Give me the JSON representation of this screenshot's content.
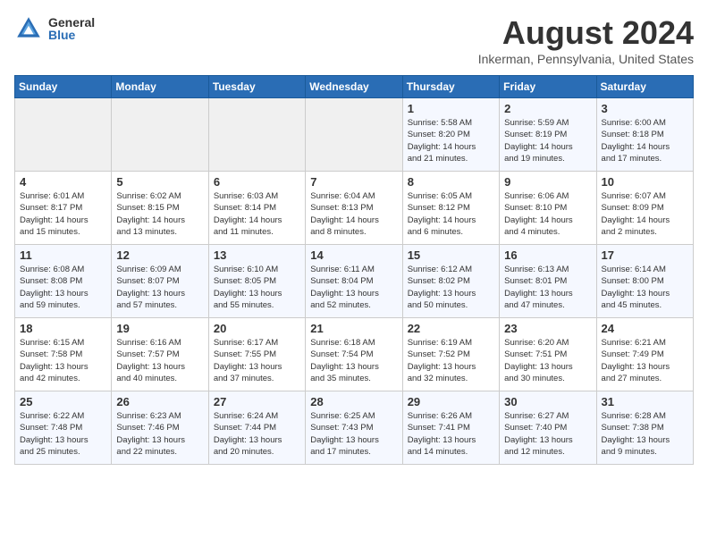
{
  "logo": {
    "general": "General",
    "blue": "Blue"
  },
  "title": {
    "month_year": "August 2024",
    "location": "Inkerman, Pennsylvania, United States"
  },
  "weekdays": [
    "Sunday",
    "Monday",
    "Tuesday",
    "Wednesday",
    "Thursday",
    "Friday",
    "Saturday"
  ],
  "weeks": [
    [
      {
        "day": "",
        "content": ""
      },
      {
        "day": "",
        "content": ""
      },
      {
        "day": "",
        "content": ""
      },
      {
        "day": "",
        "content": ""
      },
      {
        "day": "1",
        "content": "Sunrise: 5:58 AM\nSunset: 8:20 PM\nDaylight: 14 hours\nand 21 minutes."
      },
      {
        "day": "2",
        "content": "Sunrise: 5:59 AM\nSunset: 8:19 PM\nDaylight: 14 hours\nand 19 minutes."
      },
      {
        "day": "3",
        "content": "Sunrise: 6:00 AM\nSunset: 8:18 PM\nDaylight: 14 hours\nand 17 minutes."
      }
    ],
    [
      {
        "day": "4",
        "content": "Sunrise: 6:01 AM\nSunset: 8:17 PM\nDaylight: 14 hours\nand 15 minutes."
      },
      {
        "day": "5",
        "content": "Sunrise: 6:02 AM\nSunset: 8:15 PM\nDaylight: 14 hours\nand 13 minutes."
      },
      {
        "day": "6",
        "content": "Sunrise: 6:03 AM\nSunset: 8:14 PM\nDaylight: 14 hours\nand 11 minutes."
      },
      {
        "day": "7",
        "content": "Sunrise: 6:04 AM\nSunset: 8:13 PM\nDaylight: 14 hours\nand 8 minutes."
      },
      {
        "day": "8",
        "content": "Sunrise: 6:05 AM\nSunset: 8:12 PM\nDaylight: 14 hours\nand 6 minutes."
      },
      {
        "day": "9",
        "content": "Sunrise: 6:06 AM\nSunset: 8:10 PM\nDaylight: 14 hours\nand 4 minutes."
      },
      {
        "day": "10",
        "content": "Sunrise: 6:07 AM\nSunset: 8:09 PM\nDaylight: 14 hours\nand 2 minutes."
      }
    ],
    [
      {
        "day": "11",
        "content": "Sunrise: 6:08 AM\nSunset: 8:08 PM\nDaylight: 13 hours\nand 59 minutes."
      },
      {
        "day": "12",
        "content": "Sunrise: 6:09 AM\nSunset: 8:07 PM\nDaylight: 13 hours\nand 57 minutes."
      },
      {
        "day": "13",
        "content": "Sunrise: 6:10 AM\nSunset: 8:05 PM\nDaylight: 13 hours\nand 55 minutes."
      },
      {
        "day": "14",
        "content": "Sunrise: 6:11 AM\nSunset: 8:04 PM\nDaylight: 13 hours\nand 52 minutes."
      },
      {
        "day": "15",
        "content": "Sunrise: 6:12 AM\nSunset: 8:02 PM\nDaylight: 13 hours\nand 50 minutes."
      },
      {
        "day": "16",
        "content": "Sunrise: 6:13 AM\nSunset: 8:01 PM\nDaylight: 13 hours\nand 47 minutes."
      },
      {
        "day": "17",
        "content": "Sunrise: 6:14 AM\nSunset: 8:00 PM\nDaylight: 13 hours\nand 45 minutes."
      }
    ],
    [
      {
        "day": "18",
        "content": "Sunrise: 6:15 AM\nSunset: 7:58 PM\nDaylight: 13 hours\nand 42 minutes."
      },
      {
        "day": "19",
        "content": "Sunrise: 6:16 AM\nSunset: 7:57 PM\nDaylight: 13 hours\nand 40 minutes."
      },
      {
        "day": "20",
        "content": "Sunrise: 6:17 AM\nSunset: 7:55 PM\nDaylight: 13 hours\nand 37 minutes."
      },
      {
        "day": "21",
        "content": "Sunrise: 6:18 AM\nSunset: 7:54 PM\nDaylight: 13 hours\nand 35 minutes."
      },
      {
        "day": "22",
        "content": "Sunrise: 6:19 AM\nSunset: 7:52 PM\nDaylight: 13 hours\nand 32 minutes."
      },
      {
        "day": "23",
        "content": "Sunrise: 6:20 AM\nSunset: 7:51 PM\nDaylight: 13 hours\nand 30 minutes."
      },
      {
        "day": "24",
        "content": "Sunrise: 6:21 AM\nSunset: 7:49 PM\nDaylight: 13 hours\nand 27 minutes."
      }
    ],
    [
      {
        "day": "25",
        "content": "Sunrise: 6:22 AM\nSunset: 7:48 PM\nDaylight: 13 hours\nand 25 minutes."
      },
      {
        "day": "26",
        "content": "Sunrise: 6:23 AM\nSunset: 7:46 PM\nDaylight: 13 hours\nand 22 minutes."
      },
      {
        "day": "27",
        "content": "Sunrise: 6:24 AM\nSunset: 7:44 PM\nDaylight: 13 hours\nand 20 minutes."
      },
      {
        "day": "28",
        "content": "Sunrise: 6:25 AM\nSunset: 7:43 PM\nDaylight: 13 hours\nand 17 minutes."
      },
      {
        "day": "29",
        "content": "Sunrise: 6:26 AM\nSunset: 7:41 PM\nDaylight: 13 hours\nand 14 minutes."
      },
      {
        "day": "30",
        "content": "Sunrise: 6:27 AM\nSunset: 7:40 PM\nDaylight: 13 hours\nand 12 minutes."
      },
      {
        "day": "31",
        "content": "Sunrise: 6:28 AM\nSunset: 7:38 PM\nDaylight: 13 hours\nand 9 minutes."
      }
    ]
  ]
}
